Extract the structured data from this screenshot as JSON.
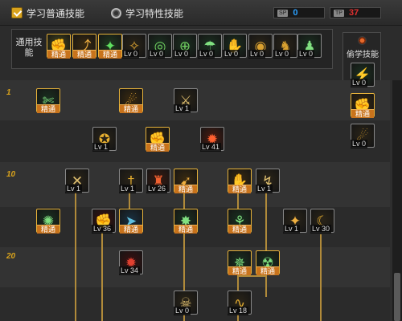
{
  "tabs": [
    {
      "label": "学习普通技能",
      "active": true,
      "icon": "check-icon"
    },
    {
      "label": "学习特性技能",
      "active": false,
      "icon": "radio-icon"
    }
  ],
  "sp": {
    "label": "SP",
    "value": "0",
    "value_color": "#2aa0ff"
  },
  "tp": {
    "label": "TP",
    "value": "37",
    "value_color": "#e03030"
  },
  "common": {
    "title": "通用技能",
    "skills": [
      {
        "icon": "claw-icon",
        "glyph": "✊",
        "bg": "#4a4a1a",
        "color": "#e8c040",
        "tag": "精通",
        "master": true
      },
      {
        "icon": "leap-icon",
        "glyph": "⤴",
        "bg": "#3a2a10",
        "color": "#f0b040",
        "tag": "精通",
        "master": true
      },
      {
        "icon": "rise-icon",
        "glyph": "✦",
        "bg": "#1f3a1f",
        "color": "#60e060",
        "tag": "精通",
        "master": true
      },
      {
        "icon": "wings-icon",
        "glyph": "✧",
        "bg": "#2a2418",
        "color": "#d8a030",
        "tag": "Lv 0",
        "master": false
      },
      {
        "icon": "target-icon",
        "glyph": "◎",
        "bg": "#1a3020",
        "color": "#70d060",
        "tag": "Lv 0",
        "master": false
      },
      {
        "icon": "crosshair-icon",
        "glyph": "⊕",
        "bg": "#1a3020",
        "color": "#70d060",
        "tag": "Lv 0",
        "master": false
      },
      {
        "icon": "runner-icon",
        "glyph": "☂",
        "bg": "#1a3020",
        "color": "#80e080",
        "tag": "Lv 0",
        "master": false
      },
      {
        "icon": "fist-icon",
        "glyph": "✋",
        "bg": "#1a3020",
        "color": "#80e080",
        "tag": "Lv 0",
        "master": false
      },
      {
        "icon": "ring-icon",
        "glyph": "◉",
        "bg": "#2a2418",
        "color": "#d8a030",
        "tag": "Lv 0",
        "master": false
      },
      {
        "icon": "strong-icon",
        "glyph": "♞",
        "bg": "#2a2418",
        "color": "#d8a030",
        "tag": "Lv 0",
        "master": false
      },
      {
        "icon": "spirit-icon",
        "glyph": "♟",
        "bg": "#1a3020",
        "color": "#80e080",
        "tag": "Lv 0",
        "master": false
      }
    ]
  },
  "steal": {
    "title": "偷学技能",
    "skills": [
      {
        "icon": "charge-icon",
        "glyph": "⚡",
        "bg": "#1a3020",
        "color": "#80e080",
        "tag": "Lv 0",
        "master": false
      },
      {
        "icon": "grab-icon",
        "glyph": "✊",
        "bg": "#3a2a10",
        "color": "#f0b040",
        "tag": "精通",
        "master": true
      },
      {
        "icon": "bomb-icon",
        "glyph": "☄",
        "bg": "#2a2418",
        "color": "#d8a030",
        "tag": "Lv 0",
        "master": false
      }
    ]
  },
  "levels": [
    "1",
    "10",
    "20"
  ],
  "tree": [
    {
      "icon": "slash-icon",
      "glyph": "✄",
      "bg": "#1a3020",
      "color": "#80e080",
      "tag": "精通",
      "master": true
    },
    {
      "icon": "kick-icon",
      "glyph": "☄",
      "bg": "#3a2a10",
      "color": "#f0b040",
      "tag": "精通",
      "master": true
    },
    {
      "icon": "blade-icon",
      "glyph": "⚔",
      "bg": "#2a2418",
      "color": "#e0c070",
      "tag": "Lv 1",
      "master": false
    },
    {
      "icon": "throw-icon",
      "glyph": "✪",
      "bg": "#2a2418",
      "color": "#e8b030",
      "tag": "Lv 1",
      "master": false
    },
    {
      "icon": "uppercut-icon",
      "glyph": "✊",
      "bg": "#3a2a10",
      "color": "#f0b040",
      "tag": "精通",
      "master": true
    },
    {
      "icon": "flame-icon",
      "glyph": "✹",
      "bg": "#4a1a10",
      "color": "#ff6030",
      "tag": "Lv 41",
      "master": false
    },
    {
      "icon": "crossblade-icon",
      "glyph": "✕",
      "bg": "#2a2418",
      "color": "#e0c070",
      "tag": "Lv 1",
      "master": false
    },
    {
      "icon": "dagger-icon",
      "glyph": "†",
      "bg": "#2a2418",
      "color": "#e8b030",
      "tag": "Lv 1",
      "master": false
    },
    {
      "icon": "tower-icon",
      "glyph": "♜",
      "bg": "#3a1a10",
      "color": "#f06030",
      "tag": "Lv 26",
      "master": false
    },
    {
      "icon": "sprint-icon",
      "glyph": "➹",
      "bg": "#3a2a10",
      "color": "#f0b040",
      "tag": "精通",
      "master": true
    },
    {
      "icon": "guard-icon",
      "glyph": "✋",
      "bg": "#3a2a10",
      "color": "#f0b040",
      "tag": "精通",
      "master": true
    },
    {
      "icon": "pierce-icon",
      "glyph": "↯",
      "bg": "#2a2418",
      "color": "#e0c070",
      "tag": "Lv 1",
      "master": false
    },
    {
      "icon": "burst-icon",
      "glyph": "✺",
      "bg": "#1a3020",
      "color": "#80e080",
      "tag": "精通",
      "master": true
    },
    {
      "icon": "red-fist-icon",
      "glyph": "✊",
      "bg": "#3a1010",
      "color": "#e04030",
      "tag": "Lv 36",
      "master": false
    },
    {
      "icon": "dash-icon",
      "glyph": "➤",
      "bg": "#1a3040",
      "color": "#60c0e0",
      "tag": "精通",
      "master": true
    },
    {
      "icon": "explode-icon",
      "glyph": "✸",
      "bg": "#1a3020",
      "color": "#80e080",
      "tag": "精通",
      "master": true
    },
    {
      "icon": "grapple-icon",
      "glyph": "⚘",
      "bg": "#1a3020",
      "color": "#80e080",
      "tag": "精通",
      "master": true
    },
    {
      "icon": "spark-icon",
      "glyph": "✦",
      "bg": "#2a2418",
      "color": "#f0b040",
      "tag": "Lv 1",
      "master": false
    },
    {
      "icon": "crescent-icon",
      "glyph": "☾",
      "bg": "#2a2418",
      "color": "#e8b030",
      "tag": "Lv 30",
      "master": false
    },
    {
      "icon": "rage-icon",
      "glyph": "✹",
      "bg": "#3a1010",
      "color": "#e04030",
      "tag": "Lv 34",
      "master": false
    },
    {
      "icon": "shock-icon",
      "glyph": "✵",
      "bg": "#1a3020",
      "color": "#80e080",
      "tag": "精通",
      "master": true
    },
    {
      "icon": "cyclone-icon",
      "glyph": "☢",
      "bg": "#1a3020",
      "color": "#80e080",
      "tag": "精通",
      "master": true
    },
    {
      "icon": "demon-icon",
      "glyph": "☠",
      "bg": "#2a2418",
      "color": "#e0c070",
      "tag": "Lv 0",
      "master": false
    },
    {
      "icon": "wave-icon",
      "glyph": "∿",
      "bg": "#2a2418",
      "color": "#e8b030",
      "tag": "Lv 18",
      "master": false
    }
  ],
  "colors": {
    "accent": "#d8a21c",
    "mastered": "#c8731c",
    "background": "#2c2c2c"
  }
}
